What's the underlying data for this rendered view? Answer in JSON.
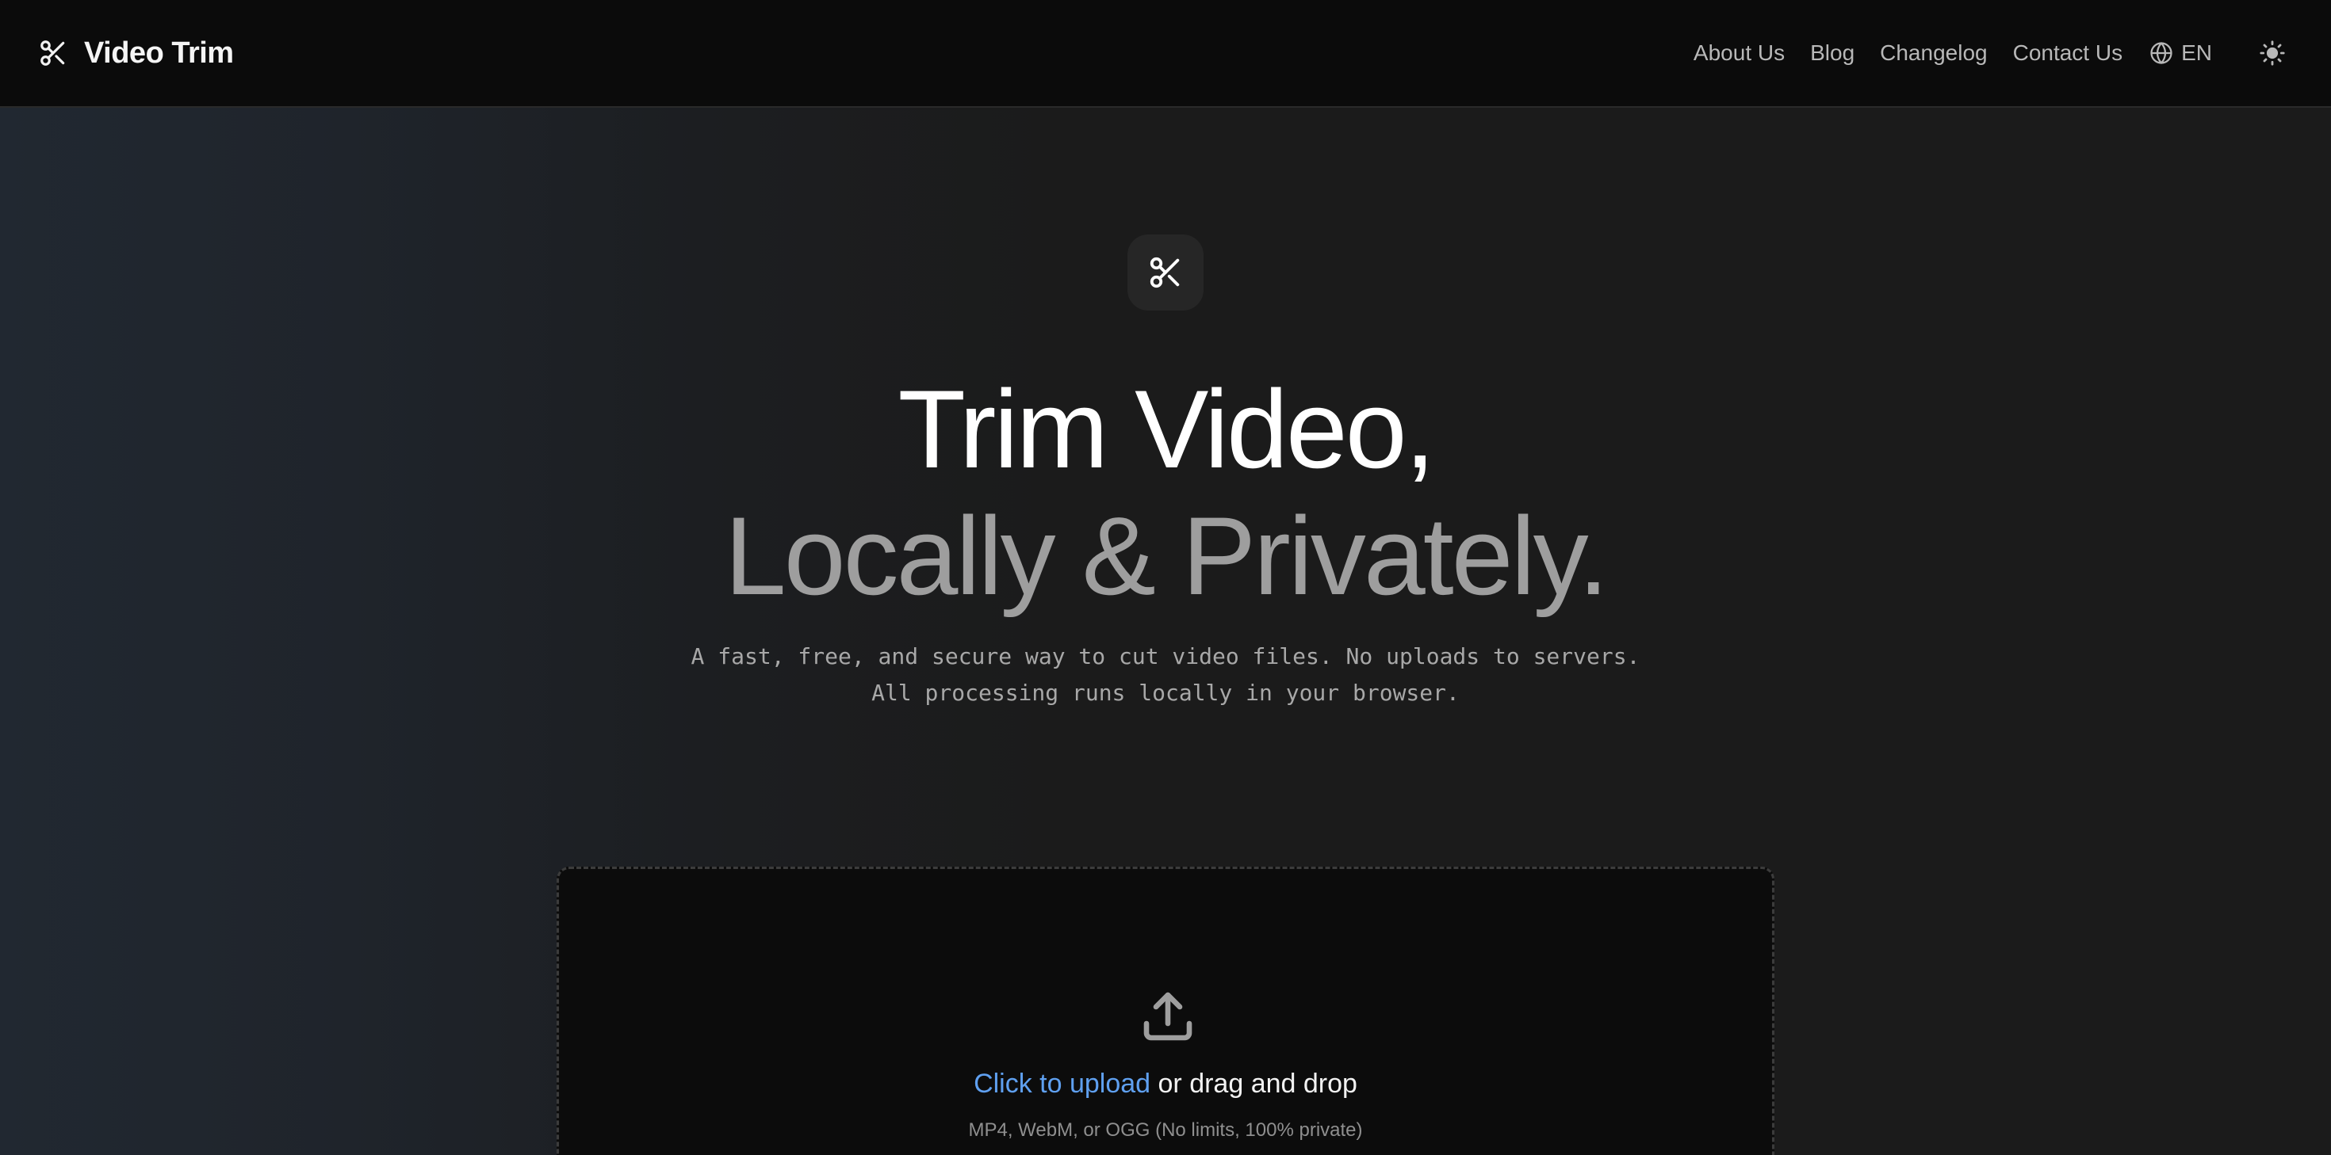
{
  "header": {
    "brand_title": "Video Trim",
    "brand_icon": "scissors-icon",
    "nav": [
      {
        "label": "About Us"
      },
      {
        "label": "Blog"
      },
      {
        "label": "Changelog"
      },
      {
        "label": "Contact Us"
      }
    ],
    "language": {
      "label": "EN",
      "icon": "globe-icon"
    },
    "theme_toggle_icon": "sun-icon"
  },
  "hero": {
    "badge_icon": "scissors-icon",
    "title_line1": "Trim Video,",
    "title_line2": "Locally & Privately.",
    "subtitle": "A fast, free, and secure way to cut video files. No uploads to servers. All processing runs locally in your browser."
  },
  "upload": {
    "icon": "upload-icon",
    "link_text": "Click to upload",
    "rest_text": " or drag and drop",
    "hint": "MP4, WebM, or OGG (No limits, 100% private)"
  },
  "colors": {
    "accent_link": "#5fa0f0",
    "background": "#1b1b1b",
    "header_bg": "#0b0b0b",
    "title_primary": "#ffffff",
    "title_secondary": "#9e9e9e"
  }
}
